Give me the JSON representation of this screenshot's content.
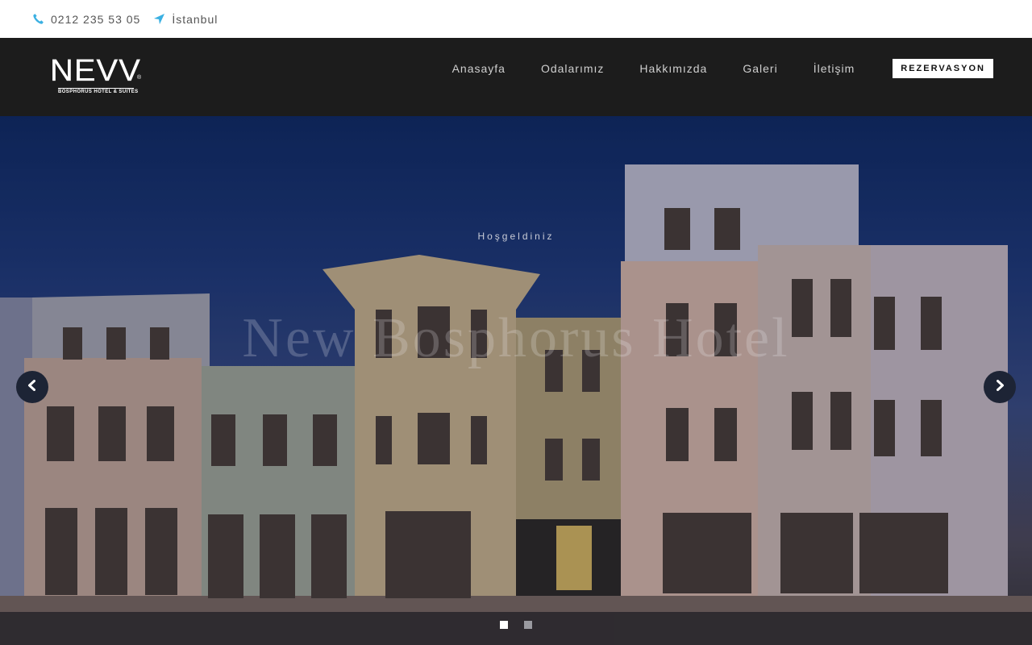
{
  "topbar": {
    "phone": "0212 235 53 05",
    "location": "İstanbul",
    "phone_icon": "phone-icon",
    "location_icon": "location-arrow-icon",
    "icon_color": "#3ab0e2"
  },
  "brand": {
    "logo_word": "NEVV",
    "logo_sub": "BOSPHORUS HOTEL & SUITES"
  },
  "nav": {
    "items": [
      {
        "label": "Anasayfa"
      },
      {
        "label": "Odalarımız"
      },
      {
        "label": "Hakkımızda"
      },
      {
        "label": "Galeri"
      },
      {
        "label": "İletişim"
      }
    ],
    "cta_label": "REZERVASYON"
  },
  "hero": {
    "welcome": "Hoşgeldiniz",
    "headline": "New Bosphorus Hotel",
    "slides_total": 2,
    "active_slide": 1
  }
}
